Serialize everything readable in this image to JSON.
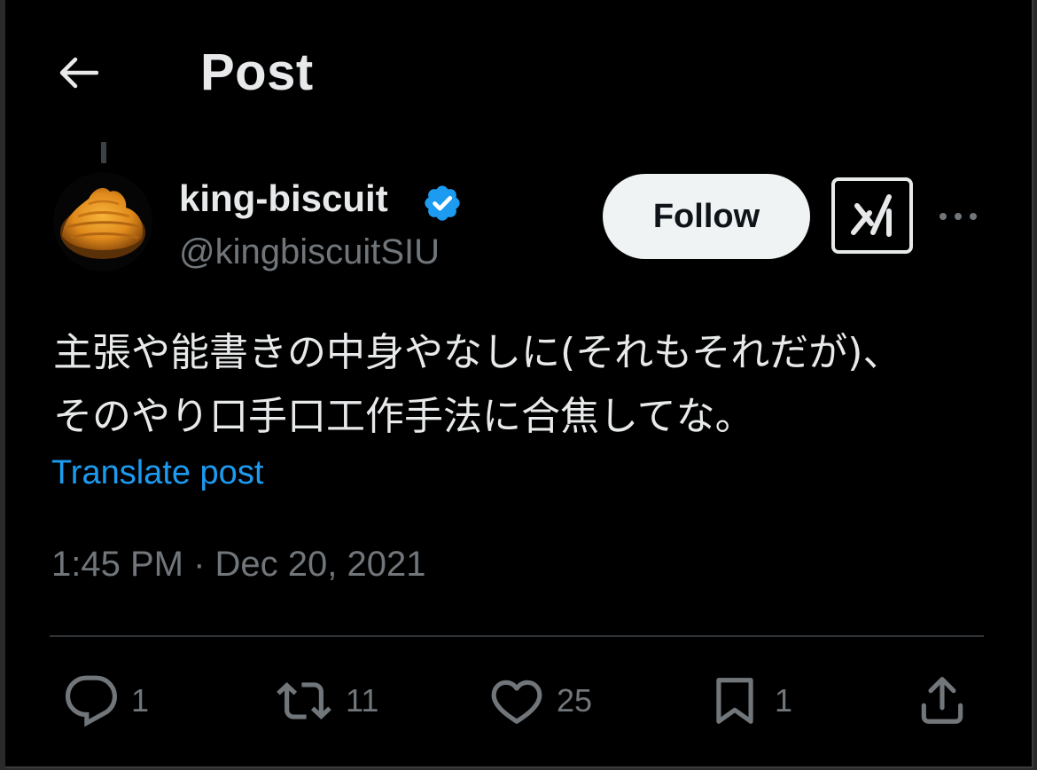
{
  "header": {
    "title": "Post",
    "back_icon": "arrow-left-icon"
  },
  "author": {
    "display_name": "king-biscuit",
    "handle": "@kingbiscuitSIU",
    "verified": true,
    "verified_color": "#1d9bf0"
  },
  "actions_top": {
    "follow_label": "Follow",
    "grok_icon": "grok-icon",
    "more_icon": "more-icon"
  },
  "post": {
    "lines": [
      "主張や能書きの中身やなしに(それもそれだが)、",
      "そのやり口手口工作手法に合焦してな。"
    ],
    "translate_label": "Translate post",
    "timestamp": "1:45 PM · Dec 20, 2021"
  },
  "engagement": {
    "replies": "1",
    "reposts": "11",
    "likes": "25",
    "bookmarks": "1"
  },
  "colors": {
    "background": "#000000",
    "text_primary": "#e7e9ea",
    "text_secondary": "#71767b",
    "accent": "#1d9bf0",
    "divider": "#2f3336"
  }
}
